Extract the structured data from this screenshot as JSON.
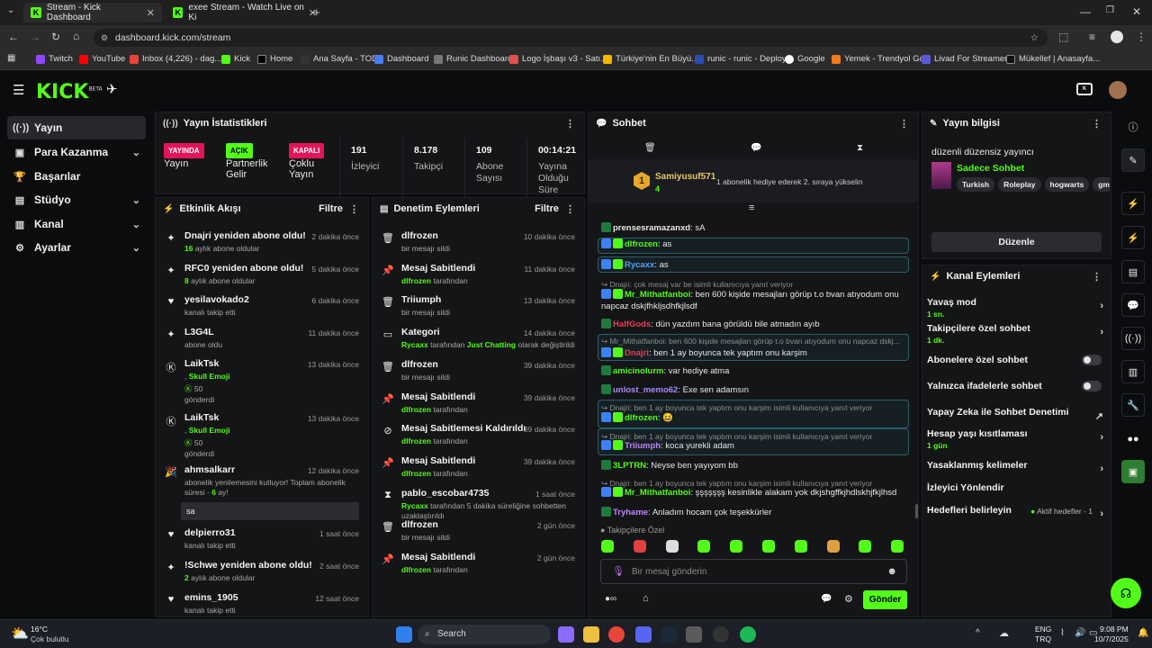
{
  "browser": {
    "tabs": [
      {
        "title": "Stream - Kick Dashboard",
        "active": true
      },
      {
        "title": "exee Stream - Watch Live on Ki",
        "active": false
      }
    ],
    "url": "dashboard.kick.com/stream",
    "bookmarks": [
      "Twitch",
      "YouTube",
      "Inbox (4,226) - dag...",
      "Kick",
      "Home",
      "Ana Sayfa - TOD",
      "Dashboard",
      "Runic Dashboard",
      "Logo İşbaşı v3 - Satı...",
      "Türkiye'nin En Büyü...",
      "runic - runic - Deploy",
      "Google",
      "Yemek - Trendyol Go",
      "Livad For Streamers",
      "Mükellef | Anasayfa..."
    ]
  },
  "header": {
    "logo": "KICK",
    "logo_sup": "BETA"
  },
  "sidebar": {
    "items": [
      {
        "label": "Yayın",
        "icon": "broadcast-icon"
      },
      {
        "label": "Para Kazanma",
        "icon": "money-icon"
      },
      {
        "label": "Başarılar",
        "icon": "trophy-icon"
      },
      {
        "label": "Stüdyo",
        "icon": "studio-icon"
      },
      {
        "label": "Kanal",
        "icon": "channel-icon"
      },
      {
        "label": "Ayarlar",
        "icon": "gear-icon"
      }
    ]
  },
  "stats": {
    "title": "Yayın İstatistikleri",
    "badges": [
      {
        "badge": "YAYINDA",
        "label": "Yayın",
        "color": "#e4145c"
      },
      {
        "badge": "AÇIK",
        "label": "Partnerlik Gelir",
        "color": "#53fc18"
      },
      {
        "badge": "KAPALI",
        "label": "Çoklu Yayın",
        "color": "#e4145c"
      }
    ],
    "values": [
      {
        "value": "191",
        "label": "İzleyici"
      },
      {
        "value": "8.178",
        "label": "Takipçi"
      },
      {
        "value": "109",
        "label": "Abone Sayısı"
      },
      {
        "value": "00:14:21",
        "label": "Yayına Olduğu Süre"
      }
    ]
  },
  "activity": {
    "title": "Etkinlik Akışı",
    "filter": "Filtre",
    "items": [
      {
        "icon": "sparkle-icon",
        "title": "Dnajri yeniden abone oldu!",
        "sub_num": "16",
        "sub": " aylık abone oldular",
        "time": "2 dakika önce"
      },
      {
        "icon": "sparkle-icon",
        "title": "RFC0 yeniden abone oldu!",
        "sub_num": "8",
        "sub": " aylık abone oldular",
        "time": "5 dakika önce"
      },
      {
        "icon": "heart-icon",
        "title": "yesilavokado2",
        "sub_num": "",
        "sub": "kanalı takip etti",
        "time": "6 dakika önce"
      },
      {
        "icon": "sparkle-icon",
        "title": "L3G4L",
        "sub_num": "",
        "sub": "abone oldu",
        "time": "11 dakika önce"
      },
      {
        "icon": "kick-coin-icon",
        "title": "LaikTsk",
        "sub_num": "",
        "sub": "",
        "time": "13 dakika önce",
        "line2": "Skull Emoji",
        "amount": "50",
        "line4": "gönderdi"
      },
      {
        "icon": "kick-coin-icon",
        "title": "LaikTsk",
        "sub_num": "",
        "sub": "",
        "time": "13 dakika önce",
        "line2": "Skull Emoji",
        "amount": "50",
        "line4": "gönderdi"
      },
      {
        "icon": "party-icon",
        "title": "ahmsalkarr",
        "time": "12 dakika önce",
        "sub": "abonelik yenilemesini kutluyor! Toplam abonelik süresi - ",
        "sub_num": "6",
        "sub_tail": " ay!",
        "msg": "sa"
      },
      {
        "icon": "heart-icon",
        "title": "delpierro31",
        "sub_num": "",
        "sub": "kanalı takip etti",
        "time": "1 saat önce"
      },
      {
        "icon": "sparkle-icon",
        "title": "!Schwe yeniden abone oldu!",
        "sub_num": "2",
        "sub": " aylık abone oldular",
        "time": "2 saat önce"
      },
      {
        "icon": "heart-icon",
        "title": "emins_1905",
        "sub_num": "",
        "sub": "kanalı takip etti",
        "time": "12 saat önce"
      }
    ]
  },
  "moderation": {
    "title": "Denetim Eylemleri",
    "filter": "Filtre",
    "items": [
      {
        "icon": "trash-icon",
        "title": "dlfrozen",
        "sub_g": "",
        "sub": "bir mesajı sildi",
        "time": "10 dakika önce"
      },
      {
        "icon": "pin-icon",
        "title": "Mesaj Sabitlendi",
        "sub_g": "dlfrozen",
        "sub": " tarafından",
        "time": "11 dakika önce"
      },
      {
        "icon": "trash-icon",
        "title": "Triiumph",
        "sub_g": "",
        "sub": "bir mesajı sildi",
        "time": "13 dakika önce"
      },
      {
        "icon": "category-icon",
        "title": "Kategori",
        "sub_g": "Rycaxx",
        "sub": " tarafından ",
        "sub_g2": "Just Chatting",
        "sub2": " olarak değiştirildi",
        "time": "14 dakika önce"
      },
      {
        "icon": "trash-icon",
        "title": "dlfrozen",
        "sub_g": "",
        "sub": "bir mesajı sildi",
        "time": "39 dakika önce"
      },
      {
        "icon": "pin-icon",
        "title": "Mesaj Sabitlendi",
        "sub_g": "dlfrozen",
        "sub": " tarafından",
        "time": "39 dakika önce"
      },
      {
        "icon": "unpin-icon",
        "title": "Mesaj Sabitlemesi Kaldırıldı",
        "sub_g": "dlfrozen",
        "sub": " tarafından",
        "time": "39 dakika önce"
      },
      {
        "icon": "pin-icon",
        "title": "Mesaj Sabitlendi",
        "sub_g": "dlfrozen",
        "sub": " tarafından",
        "time": "39 dakika önce"
      },
      {
        "icon": "hourglass-icon",
        "title": "pablo_escobar4735",
        "sub_g": "Rycaxx",
        "sub": " tarafından 5 dakika süreliğine sohbetten uzaklaştırıldı",
        "time": "1 saat önce"
      },
      {
        "icon": "trash-icon",
        "title": "dlfrozen",
        "sub_g": "",
        "sub": "bir mesajı sildi",
        "time": "2 gün önce"
      },
      {
        "icon": "pin-icon",
        "title": "Mesaj Sabitlendi",
        "sub_g": "dlfrozen",
        "sub": " tarafından",
        "time": "2 gün önce"
      }
    ]
  },
  "chat": {
    "title": "Sohbet",
    "gift_rank": "1",
    "gift_user": "Samiyusuf571",
    "gift_count": "4",
    "gift_text": "1 abonelik hediye ederek 2. sıraya yükselin",
    "messages": [
      {
        "user": "prensesramazanxd",
        "color": "#e8e8e8",
        "text": "sA"
      },
      {
        "user": "dlfrozen",
        "color": "#53fc18",
        "text": "as",
        "hl": true
      },
      {
        "user": "Rycaxx",
        "color": "#53a2fc",
        "text": "as",
        "hl": true
      },
      {
        "reply": "Dnajri: çok mesaj var be isimli kullanıcıya yanıt veriyor",
        "user": "Mr_Mithatfanboi",
        "color": "#53fc18",
        "text": "ben 600 kişide mesajları görüp t.o bvan atıyodum onu napcaz dskjfhkljsdhfkjlsdf"
      },
      {
        "user": "HalfGods",
        "color": "#e0405a",
        "text": "dün yazdım bana görüldü bile atmadın ayıb"
      },
      {
        "reply": "Mr_Mithatfanboi: ben 600 kişide mesajları görüp t.o bvan atıyodum onu napcaz dskj...",
        "user": "Dnajri",
        "color": "#e0405a",
        "text": "ben 1 ay boyunca tek yaptım onu karşim",
        "hl": true
      },
      {
        "user": "amicinolurm",
        "color": "#53fc18",
        "text": "var hediye atma"
      },
      {
        "user": "unlost_memo62",
        "color": "#a78bfa",
        "text": "Exe sen adamsın"
      },
      {
        "reply": "Dnajri: ben 1 ay boyunca tek yaptım onu karşim isimli kullanıcıya yanıt veriyor",
        "user": "dlfrozen",
        "color": "#53fc18",
        "text": "😆",
        "hl": true
      },
      {
        "reply": "Dnajri: ben 1 ay boyunca tek yaptım onu karşim isimli kullanıcıya yanıt veriyor",
        "user": "Triiumph",
        "color": "#c084fc",
        "text": "koca yurekli adam",
        "hl": true
      },
      {
        "user": "3LPTRN",
        "color": "#53fc18",
        "text": "Neyse ben yayıyom bb"
      },
      {
        "reply": "Dnajri: ben 1 ay boyunca tek yaptım onu karşim isimli kullanıcıya yanıt veriyor",
        "user": "Mr_Mithatfanboi",
        "color": "#53fc18",
        "text": "şşşşşşş kesinlikle alakam yok dkjshgffkjhdlskhjfkjlhsd"
      },
      {
        "user": "Tryhame",
        "color": "#c084fc",
        "text": "Anladım hocam çok teşekkürler"
      }
    ],
    "followers_only": "Takipçilere Özel",
    "input_placeholder": "Bir mesaj gönderin",
    "send": "Gönder"
  },
  "stream_info": {
    "title": "Yayın bilgisi",
    "stream_title": "düzenli düzensiz yayıncı",
    "category": "Sadece Sohbet",
    "tags": [
      "Turkish",
      "Roleplay",
      "hogwarts",
      "gm"
    ],
    "edit": "Düzenle"
  },
  "channel_actions": {
    "title": "Kanal Eylemleri",
    "items": [
      {
        "label": "Yavaş mod",
        "sub": "1 sn.",
        "type": "chev"
      },
      {
        "label": "Takipçilere özel sohbet",
        "sub": "1 dk.",
        "type": "chev"
      },
      {
        "label": "Abonelere özel sohbet",
        "sub": "",
        "type": "toggle"
      },
      {
        "label": "Yalnızca ifadelerle sohbet",
        "sub": "",
        "type": "toggle"
      },
      {
        "label": "Yapay Zeka ile Sohbet Denetimi",
        "sub": "",
        "type": "ext"
      },
      {
        "label": "Hesap yaşı kısıtlaması",
        "sub": "1 gün",
        "type": "chev"
      },
      {
        "label": "Yasaklanmış kelimeler",
        "sub": "",
        "type": "chev"
      },
      {
        "label": "İzleyici Yönlendir",
        "sub": "",
        "type": "none"
      },
      {
        "label": "Hedefleri belirleyin",
        "sub": "",
        "type": "goal",
        "goal": "Aktif hedefler - 1"
      }
    ]
  },
  "taskbar": {
    "weather_temp": "16°C",
    "weather_desc": "Çok bulutlu",
    "search": "Search",
    "lang1": "ENG",
    "lang2": "TRQ",
    "time": "9:08 PM",
    "date": "10/7/2025"
  }
}
